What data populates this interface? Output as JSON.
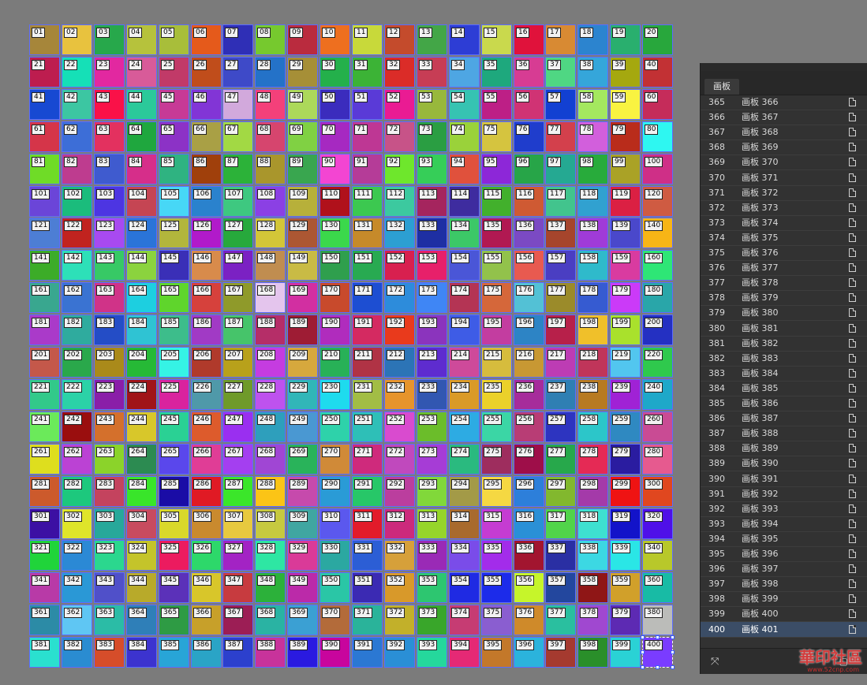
{
  "canvas": {
    "colors": [
      "#a6863a",
      "#e8c23e",
      "#27a84b",
      "#b6c23c",
      "#a8be3a",
      "#e55a1b",
      "#2f2fb6",
      "#76c92e",
      "#ba2b3e",
      "#ee6f1f",
      "#c8d93a",
      "#c44b2c",
      "#43a647",
      "#2d3dd5",
      "#c9d94d",
      "#e0123b",
      "#d88a33",
      "#2c84cf",
      "#29af6e",
      "#28a73c",
      "#bd1d4f",
      "#15e0b7",
      "#e228a0",
      "#d85b99",
      "#c13a68",
      "#c04d1b",
      "#3e4ac8",
      "#2472c8",
      "#a68f37",
      "#24b04b",
      "#3cb336",
      "#db2c28",
      "#c73d55",
      "#4ea6e3",
      "#1ea87d",
      "#d73c93",
      "#4fd783",
      "#35a6da",
      "#a5a80f",
      "#c23134",
      "#1749d2",
      "#3cc6a2",
      "#fa1148",
      "#2bc99a",
      "#c73a96",
      "#8235d6",
      "#d2a9dc",
      "#f4407a",
      "#acd85a",
      "#3b2cbd",
      "#5a3ad7",
      "#ea1b93",
      "#98b83c",
      "#36c3b2",
      "#bd1f86",
      "#d03374",
      "#1240d2",
      "#a4e85f",
      "#f9f341",
      "#c52c5a",
      "#d53549",
      "#3d6ed7",
      "#e3315f",
      "#1fa73e",
      "#8c32c6",
      "#a9a045",
      "#a2d944",
      "#d6456e",
      "#80d143",
      "#a629c1",
      "#be3794",
      "#c75388",
      "#2a9e42",
      "#9ad23a",
      "#d5c43f",
      "#1f3dcc",
      "#d3404c",
      "#d25fdc",
      "#b92c1b",
      "#2ef7f1",
      "#6fdc27",
      "#be3c8f",
      "#3f5bcf",
      "#d62e8a",
      "#2fb381",
      "#a0400b",
      "#2cb239",
      "#a9962c",
      "#39a64f",
      "#f345d2",
      "#b53c98",
      "#6ee72c",
      "#36ce58",
      "#e0513c",
      "#8d27d8",
      "#27a548",
      "#25a992",
      "#28ab3b",
      "#aaa226",
      "#cf2f87",
      "#6b45d8",
      "#1bbc7c",
      "#4d35e2",
      "#c54553",
      "#47d7f6",
      "#2a82cd",
      "#3ec880",
      "#8b40e4",
      "#b7b03a",
      "#b0111b",
      "#3cc850",
      "#3cc99f",
      "#a5255e",
      "#3e2c9f",
      "#42b02c",
      "#cf5a33",
      "#42c48d",
      "#31a1d0",
      "#db2043",
      "#cf5b42",
      "#4d7ed4",
      "#c1231f",
      "#a84af0",
      "#2a74d8",
      "#b2b63c",
      "#b11aca",
      "#27a93c",
      "#d3c638",
      "#ac5733",
      "#3bd84b",
      "#c68a2a",
      "#2c9fd2",
      "#1e2fa3",
      "#3cc867",
      "#b11952",
      "#7b4ac3",
      "#a6452c",
      "#a03bd8",
      "#4a48cb",
      "#f7b516",
      "#3cac28",
      "#2de0b8",
      "#37c965",
      "#8bd33e",
      "#3a2fb7",
      "#d88b4b",
      "#7b21c3",
      "#c08d50",
      "#c9bb45",
      "#2f9f4d",
      "#28aa51",
      "#d8204f",
      "#e7206a",
      "#4a56d7",
      "#92c24b",
      "#e85a50",
      "#4a3ec2",
      "#2fbacb",
      "#d93ba0",
      "#2ee676",
      "#39a78f",
      "#3a73d2",
      "#d03388",
      "#1dcfe0",
      "#5fd52c",
      "#d6413c",
      "#8f9a2a",
      "#e4c5ed",
      "#d22fa1",
      "#c84a2c",
      "#1d4ed2",
      "#2d8cdb",
      "#3f86f5",
      "#b43454",
      "#d5673a",
      "#53c1d5",
      "#9b8b2a",
      "#365bd1",
      "#cb3af8",
      "#29a6a9",
      "#aa3ac9",
      "#2fab9e",
      "#244dc6",
      "#2fc3d3",
      "#3dbd8b",
      "#a13ac5",
      "#46c46a",
      "#b52e68",
      "#9e1c34",
      "#b02cbd",
      "#d42a61",
      "#e93a1c",
      "#8b34bd",
      "#3e5ce6",
      "#c33da0",
      "#2d84c5",
      "#b7204a",
      "#f0c02a",
      "#a9e12c",
      "#2430c2",
      "#c4584a",
      "#2aa84b",
      "#aa8a1a",
      "#26b936",
      "#35f3e5",
      "#b03a2b",
      "#b8a11b",
      "#c53ce0",
      "#d6a83d",
      "#28b157",
      "#b03345",
      "#2c74b6",
      "#5e2ccf",
      "#ce4a9a",
      "#d6bc3d",
      "#c89833",
      "#bd3cb4",
      "#c0355a",
      "#52c6ef",
      "#2fc94d",
      "#32c98a",
      "#2bd2a7",
      "#8a1ea8",
      "#a01418",
      "#d9239e",
      "#4f99a9",
      "#6f9a2a",
      "#be52ee",
      "#31b6b8",
      "#1edbee",
      "#a2bd45",
      "#e6942c",
      "#3257b1",
      "#da9a27",
      "#ebd12a",
      "#a62c9b",
      "#2f7fb3",
      "#b77a21",
      "#a022d5",
      "#1ea8c9",
      "#6bea5a",
      "#9a0e0e",
      "#d4702c",
      "#d8c72a",
      "#2ad194",
      "#dd5b2c",
      "#9a2ff0",
      "#2e9fbc",
      "#4a98d2",
      "#2ed2aa",
      "#2ebfb7",
      "#d94bcf",
      "#6bbd2a",
      "#2dabe3",
      "#3bd6a5",
      "#b83d75",
      "#2d34c0",
      "#2cc6c9",
      "#2f89c1",
      "#c94b94",
      "#dede1e",
      "#bb42d4",
      "#8bd32a",
      "#2c8b51",
      "#5a47ec",
      "#e03d96",
      "#a43ff0",
      "#a046d4",
      "#29b35a",
      "#d08a38",
      "#cf2a7c",
      "#c049bd",
      "#a63cd6",
      "#2aba7f",
      "#9e2d5e",
      "#9e0e49",
      "#27a84b",
      "#e52a55",
      "#2a1ca0",
      "#e65a8f",
      "#cc5a2c",
      "#1dc87d",
      "#c4435e",
      "#39e52a",
      "#1a0ca6",
      "#e01a24",
      "#3be62a",
      "#fbc416",
      "#c64aac",
      "#2a9bd6",
      "#27c768",
      "#bb3e9e",
      "#81d83a",
      "#a39a47",
      "#f5d842",
      "#2d7fda",
      "#82b82e",
      "#a43aa9",
      "#ef1313",
      "#e0471f",
      "#3c10a3",
      "#dfe52a",
      "#27a89a",
      "#c84b5f",
      "#d9d82a",
      "#c98a2e",
      "#e7c93f",
      "#c6c940",
      "#40a6a1",
      "#5b58ee",
      "#e21b2a",
      "#cc2a7c",
      "#96d52a",
      "#a86a2d",
      "#c53cd2",
      "#2a90d6",
      "#51d44a",
      "#3ee0d0",
      "#1313c9",
      "#4f10e8",
      "#20d43a",
      "#2b89d5",
      "#2bd78e",
      "#c4c42a",
      "#ec1b5f",
      "#2dd86a",
      "#a323c4",
      "#2ee6a3",
      "#da3a98",
      "#2ba8a1",
      "#2c5ed5",
      "#d6a03a",
      "#9a2ab6",
      "#7a4ce9",
      "#a32cea",
      "#a2152f",
      "#2a2fa3",
      "#3cd8e3",
      "#2ae6e6",
      "#b8c82a",
      "#b83aa7",
      "#2a98d6",
      "#5050c9",
      "#b8aa2a",
      "#5b31b9",
      "#d8c62a",
      "#c73b3f",
      "#2cb13a",
      "#bb2aa9",
      "#2ac6a6",
      "#3b2ab3",
      "#d8992a",
      "#2dc670",
      "#1f2ae3",
      "#1c2bea",
      "#c6f52a",
      "#23479e",
      "#8f1616",
      "#d1a02a",
      "#18bba5",
      "#2c8ba6",
      "#5fc6f3",
      "#2bbca6",
      "#2f7fb8",
      "#2e9b44",
      "#c7a02a",
      "#9c1e55",
      "#2ab3a3",
      "#3ba0d3",
      "#b36b3a",
      "#2ab39a",
      "#c2b02a",
      "#39a62a",
      "#c63c73",
      "#8a5ed0",
      "#cf8a2a",
      "#2abf9f",
      "#a048d0",
      "#5d2ab3",
      "#bbbcb9",
      "#2ae0cf",
      "#2a8cd1",
      "#d64d2a",
      "#3c33cf",
      "#28a5d7",
      "#2aa4c6",
      "#2c40cd",
      "#c8339b",
      "#2a1ae0",
      "#c8059d",
      "#2b78d3",
      "#2a8fd6",
      "#25d89c",
      "#e52975",
      "#c3782a",
      "#2bb3dc",
      "#a53a2f",
      "#2a8f2a",
      "#2ad2d5",
      "#c1c12a"
    ],
    "selected_label": "400",
    "labels": [
      "01",
      "02",
      "03",
      "04",
      "05",
      "06",
      "07",
      "08",
      "09",
      "10",
      "11",
      "12",
      "13",
      "14",
      "15",
      "16",
      "17",
      "18",
      "19",
      "20",
      "21",
      "22",
      "23",
      "24",
      "25",
      "26",
      "27",
      "28",
      "29",
      "30",
      "31",
      "32",
      "33",
      "34",
      "35",
      "36",
      "37",
      "38",
      "39",
      "40",
      "41",
      "42",
      "43",
      "44",
      "45",
      "46",
      "47",
      "48",
      "49",
      "50",
      "51",
      "52",
      "53",
      "54",
      "55",
      "56",
      "57",
      "58",
      "59",
      "60",
      "61",
      "62",
      "63",
      "64",
      "65",
      "66",
      "67",
      "68",
      "69",
      "70",
      "71",
      "72",
      "73",
      "74",
      "75",
      "76",
      "77",
      "78",
      "79",
      "80",
      "81",
      "82",
      "83",
      "84",
      "85",
      "86",
      "87",
      "88",
      "89",
      "90",
      "91",
      "92",
      "93",
      "94",
      "95",
      "96",
      "97",
      "98",
      "99",
      "100",
      "101",
      "102",
      "103",
      "104",
      "105",
      "106",
      "107",
      "108",
      "109",
      "110",
      "111",
      "112",
      "113",
      "114",
      "115",
      "116",
      "117",
      "118",
      "119",
      "120",
      "121",
      "122",
      "123",
      "124",
      "125",
      "126",
      "127",
      "128",
      "129",
      "130",
      "131",
      "132",
      "133",
      "134",
      "135",
      "136",
      "137",
      "138",
      "139",
      "140",
      "141",
      "142",
      "143",
      "144",
      "145",
      "146",
      "147",
      "148",
      "149",
      "150",
      "151",
      "152",
      "153",
      "154",
      "155",
      "156",
      "157",
      "158",
      "159",
      "160",
      "161",
      "162",
      "163",
      "164",
      "165",
      "166",
      "167",
      "168",
      "169",
      "170",
      "171",
      "172",
      "173",
      "174",
      "175",
      "176",
      "177",
      "178",
      "179",
      "180",
      "181",
      "182",
      "183",
      "184",
      "185",
      "186",
      "187",
      "188",
      "189",
      "190",
      "191",
      "192",
      "193",
      "194",
      "195",
      "196",
      "197",
      "198",
      "199",
      "200",
      "201",
      "202",
      "203",
      "204",
      "205",
      "206",
      "207",
      "208",
      "209",
      "210",
      "211",
      "212",
      "213",
      "214",
      "215",
      "216",
      "217",
      "218",
      "219",
      "220",
      "221",
      "222",
      "223",
      "224",
      "225",
      "226",
      "227",
      "228",
      "229",
      "230",
      "231",
      "232",
      "233",
      "234",
      "235",
      "236",
      "237",
      "238",
      "239",
      "240",
      "241",
      "242",
      "243",
      "244",
      "245",
      "246",
      "247",
      "248",
      "249",
      "250",
      "251",
      "252",
      "253",
      "254",
      "255",
      "256",
      "257",
      "258",
      "259",
      "260",
      "261",
      "262",
      "263",
      "264",
      "265",
      "266",
      "267",
      "268",
      "269",
      "270",
      "271",
      "272",
      "273",
      "274",
      "275",
      "276",
      "277",
      "278",
      "279",
      "280",
      "281",
      "282",
      "283",
      "284",
      "285",
      "286",
      "287",
      "288",
      "289",
      "290",
      "291",
      "292",
      "293",
      "294",
      "295",
      "296",
      "297",
      "298",
      "299",
      "300",
      "301",
      "302",
      "303",
      "304",
      "305",
      "306",
      "307",
      "308",
      "309",
      "310",
      "311",
      "312",
      "313",
      "314",
      "315",
      "316",
      "317",
      "318",
      "319",
      "320",
      "321",
      "322",
      "323",
      "324",
      "325",
      "326",
      "327",
      "328",
      "329",
      "330",
      "331",
      "332",
      "333",
      "334",
      "335",
      "336",
      "337",
      "338",
      "339",
      "340",
      "341",
      "342",
      "343",
      "344",
      "345",
      "346",
      "347",
      "348",
      "349",
      "350",
      "351",
      "352",
      "353",
      "354",
      "355",
      "356",
      "357",
      "358",
      "359",
      "360",
      "361",
      "362",
      "363",
      "364",
      "365",
      "366",
      "367",
      "368",
      "369",
      "370",
      "371",
      "372",
      "373",
      "374",
      "375",
      "376",
      "377",
      "378",
      "379",
      "380",
      "381",
      "382",
      "383",
      "384",
      "385",
      "386",
      "387",
      "388",
      "389",
      "390",
      "391",
      "392",
      "393",
      "394",
      "395",
      "396",
      "397",
      "398",
      "399",
      "400"
    ]
  },
  "panel": {
    "tab_label": "画板",
    "grid_icon": "arrange-icon",
    "new_icon": "new-artboard-icon",
    "doc_icon": "artboard-doc-icon",
    "selected_row": "400",
    "rows": [
      {
        "num": "365",
        "name": "画板  366"
      },
      {
        "num": "366",
        "name": "画板  367"
      },
      {
        "num": "367",
        "name": "画板  368"
      },
      {
        "num": "368",
        "name": "画板  369"
      },
      {
        "num": "369",
        "name": "画板  370"
      },
      {
        "num": "370",
        "name": "画板  371"
      },
      {
        "num": "371",
        "name": "画板  372"
      },
      {
        "num": "372",
        "name": "画板  373"
      },
      {
        "num": "373",
        "name": "画板  374"
      },
      {
        "num": "374",
        "name": "画板  375"
      },
      {
        "num": "375",
        "name": "画板  376"
      },
      {
        "num": "376",
        "name": "画板  377"
      },
      {
        "num": "377",
        "name": "画板  378"
      },
      {
        "num": "378",
        "name": "画板  379"
      },
      {
        "num": "379",
        "name": "画板  380"
      },
      {
        "num": "380",
        "name": "画板  381"
      },
      {
        "num": "381",
        "name": "画板  382"
      },
      {
        "num": "382",
        "name": "画板  383"
      },
      {
        "num": "383",
        "name": "画板  384"
      },
      {
        "num": "384",
        "name": "画板  385"
      },
      {
        "num": "385",
        "name": "画板  386"
      },
      {
        "num": "386",
        "name": "画板  387"
      },
      {
        "num": "387",
        "name": "画板  388"
      },
      {
        "num": "388",
        "name": "画板  389"
      },
      {
        "num": "389",
        "name": "画板  390"
      },
      {
        "num": "390",
        "name": "画板  391"
      },
      {
        "num": "391",
        "name": "画板  392"
      },
      {
        "num": "392",
        "name": "画板  393"
      },
      {
        "num": "393",
        "name": "画板  394"
      },
      {
        "num": "394",
        "name": "画板  395"
      },
      {
        "num": "395",
        "name": "画板  396"
      },
      {
        "num": "396",
        "name": "画板  397"
      },
      {
        "num": "397",
        "name": "画板  398"
      },
      {
        "num": "398",
        "name": "画板  399"
      },
      {
        "num": "399",
        "name": "画板  400"
      },
      {
        "num": "400",
        "name": "画板  401"
      }
    ]
  },
  "watermark": {
    "text": "華印社區",
    "url": "www.52cnp.com"
  }
}
